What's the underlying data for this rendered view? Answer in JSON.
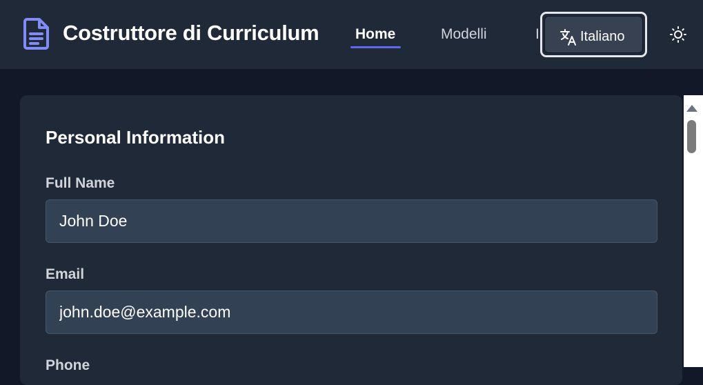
{
  "header": {
    "app_title": "Costruttore di Curriculum",
    "logo_icon": "document-icon",
    "nav": {
      "home": "Home",
      "models": "Modelli",
      "hidden_partial": "I"
    },
    "language_button": {
      "icon": "translate-icon",
      "label": "Italiano"
    },
    "theme_toggle_icon": "sun-icon"
  },
  "form": {
    "section_title": "Personal Information",
    "full_name": {
      "label": "Full Name",
      "value": "John Doe"
    },
    "email": {
      "label": "Email",
      "value": "john.doe@example.com"
    },
    "phone": {
      "label": "Phone"
    }
  },
  "colors": {
    "accent": "#6366f1",
    "header_bg": "#1f2937",
    "page_bg": "#111827",
    "input_bg": "#334155"
  }
}
